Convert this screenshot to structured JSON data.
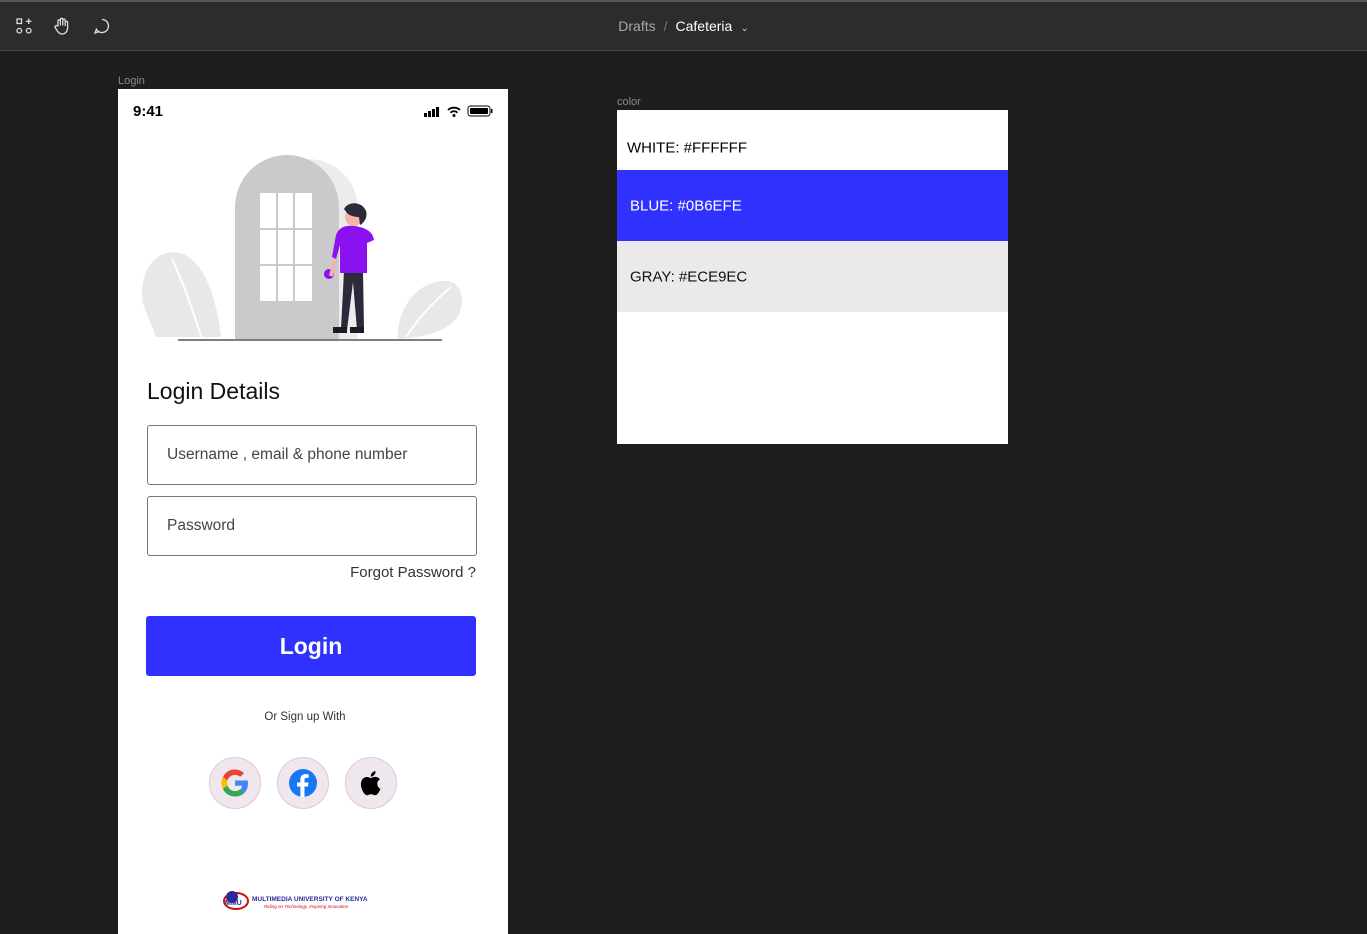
{
  "toolbar": {
    "breadcrumb": {
      "parent": "Drafts",
      "separator": "/",
      "current": "Cafeteria"
    },
    "tools": [
      "select-frame-icon",
      "hand-icon",
      "comment-icon"
    ]
  },
  "frames": {
    "login_label": "Login",
    "color_label": "color"
  },
  "phone": {
    "status": {
      "time": "9:41"
    },
    "title": "Login Details",
    "username": {
      "placeholder": "Username , email & phone number",
      "value": ""
    },
    "password": {
      "placeholder": "Password",
      "value": ""
    },
    "forgot": "Forgot Password ?",
    "login_button": "Login",
    "or_signup": "Or Sign up With",
    "social": [
      "google-icon",
      "facebook-icon",
      "apple-icon"
    ],
    "university": {
      "name": "MULTIMEDIA UNIVERSITY OF KENYA",
      "tagline": "Riding on Technology, Inspiring Innovation"
    }
  },
  "colors": {
    "white": {
      "label": "WHITE: #FFFFFF",
      "bg": "#FFFFFF",
      "fg": "#000000"
    },
    "blue": {
      "label": "BLUE:  #0B6EFE",
      "bg": "#3030FF",
      "fg": "#FFFFFF"
    },
    "gray": {
      "label": "GRAY: #ECE9EC",
      "bg": "#ECE9EC",
      "fg": "#111111"
    }
  },
  "accent": "#3030FF"
}
